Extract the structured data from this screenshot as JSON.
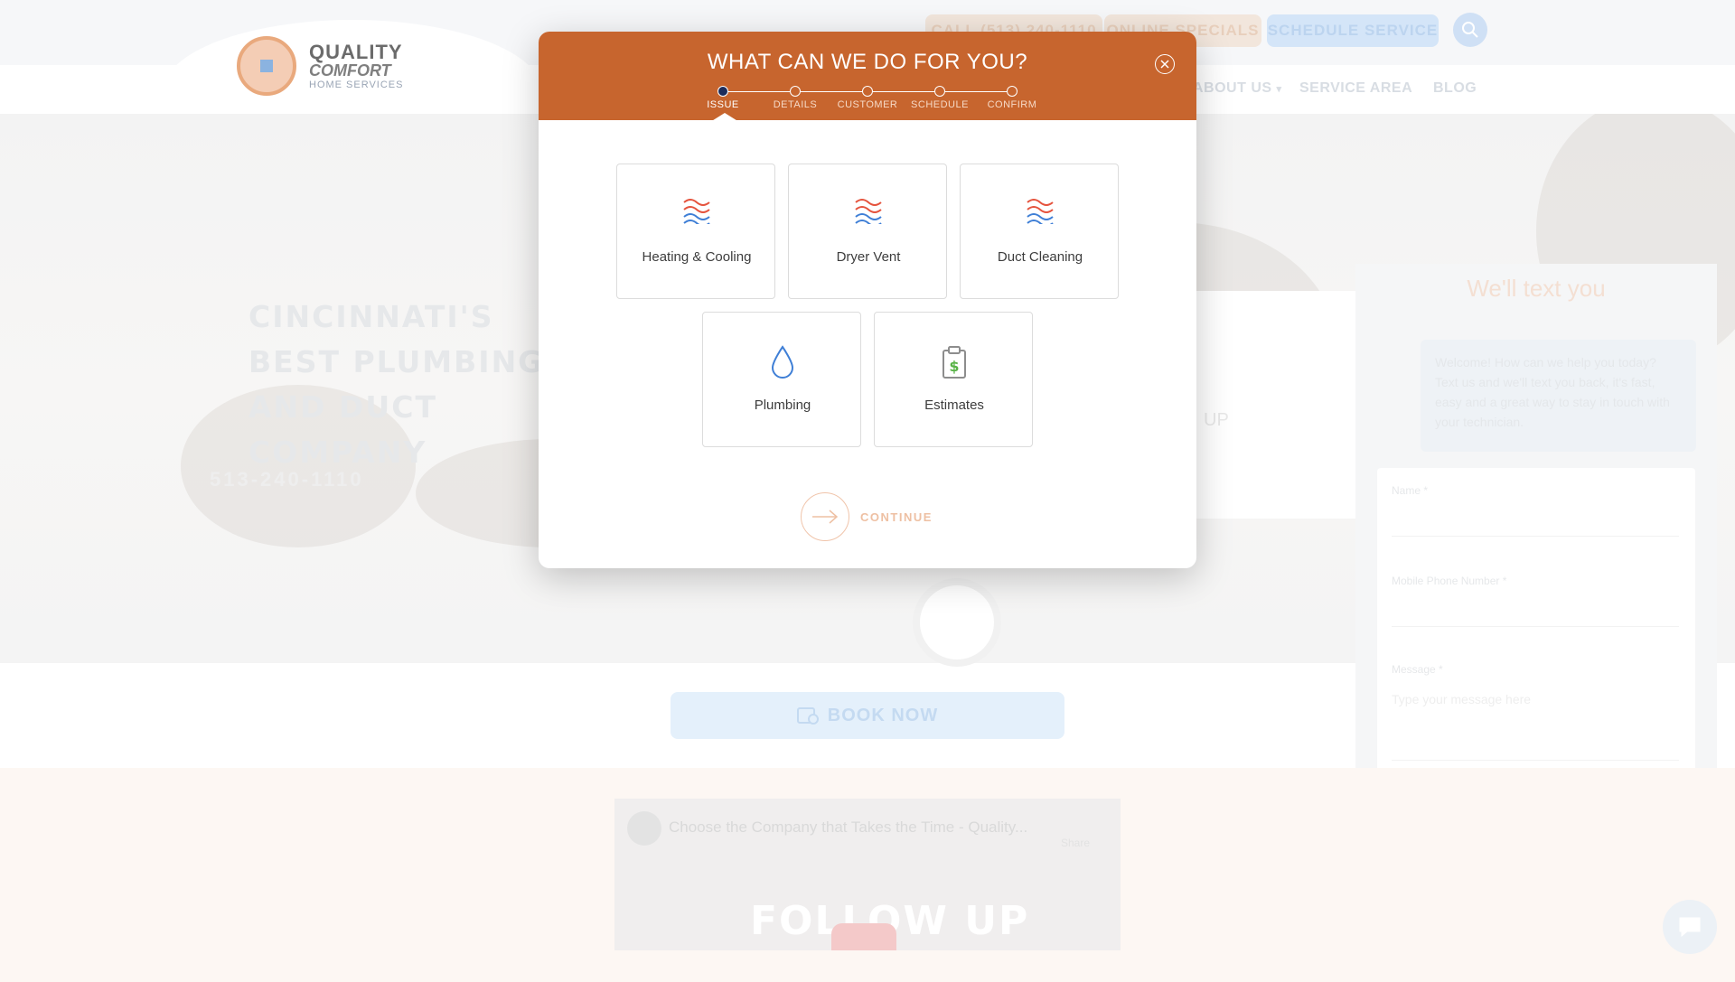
{
  "header": {
    "logo": {
      "line1": "QUALITY",
      "line2": "COMFORT",
      "line3": "HOME SERVICES"
    },
    "buttons": {
      "call": "CALL (513) 240-1110",
      "specials": "ONLINE SPECIALS",
      "schedule": "SCHEDULE SERVICE"
    },
    "nav": {
      "about": "ABOUT US",
      "service_area": "SERVICE AREA",
      "blog": "BLOG"
    }
  },
  "hero": {
    "title": "CINCINNATI'S BEST PLUMBING AND DUCT COMPANY",
    "sub": "513-240-1110",
    "mid_text": "UP"
  },
  "text_widget": {
    "title": "We'll text you",
    "bubble": "Welcome! How can we help you today? Text us and we'll text you back, it's fast, easy and a great way to stay in touch with your technician.",
    "name_label": "Name *",
    "phone_label": "Mobile Phone Number *",
    "message_label": "Message *",
    "message_placeholder": "Type your message here"
  },
  "book_now": {
    "label": "BOOK NOW"
  },
  "video": {
    "title": "Choose the Company that Takes the Time - Quality...",
    "share": "Share",
    "overlay": "FOLLOW UP"
  },
  "modal": {
    "title": "WHAT CAN WE DO FOR YOU?",
    "steps": [
      {
        "label": "ISSUE",
        "active": true
      },
      {
        "label": "DETAILS",
        "active": false
      },
      {
        "label": "CUSTOMER",
        "active": false
      },
      {
        "label": "SCHEDULE",
        "active": false
      },
      {
        "label": "CONFIRM",
        "active": false
      }
    ],
    "options": [
      {
        "label": "Heating & Cooling",
        "icon": "heating-cooling-icon"
      },
      {
        "label": "Dryer Vent",
        "icon": "dryer-vent-icon"
      },
      {
        "label": "Duct Cleaning",
        "icon": "duct-cleaning-icon"
      },
      {
        "label": "Plumbing",
        "icon": "water-drop-icon"
      },
      {
        "label": "Estimates",
        "icon": "clipboard-dollar-icon"
      }
    ],
    "continue_label": "CONTINUE"
  },
  "colors": {
    "modal_header": "#c7652e",
    "active_step": "#1d2c5a",
    "wave_red": "#e5533d",
    "wave_blue": "#3f7fd6",
    "estimate_green": "#59b347"
  }
}
